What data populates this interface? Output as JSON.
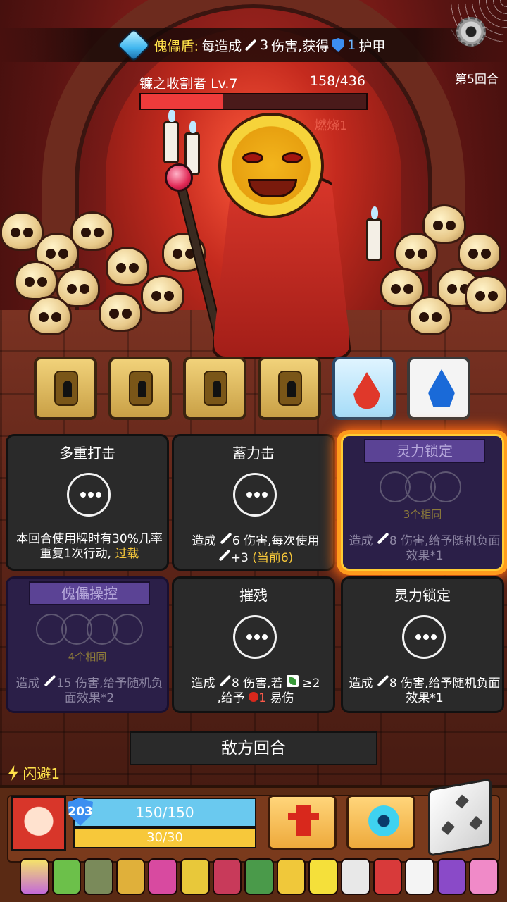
{
  "buff": {
    "icon": "puppet-shield-gem-icon",
    "name": "傀儡盾:",
    "text_before": "每造成",
    "damage": "3",
    "text_mid": "伤害,获得",
    "armor": "1",
    "text_after": "护甲"
  },
  "round": "第5回合",
  "boss": {
    "name": "镰之收割者",
    "level": "Lv.7",
    "hp_text": "158/436",
    "hp_fraction": 0.362,
    "status": "燃烧1"
  },
  "reward_boxes": [
    {
      "kind": "locked-chest"
    },
    {
      "kind": "locked-chest"
    },
    {
      "kind": "locked-chest"
    },
    {
      "kind": "locked-chest"
    },
    {
      "kind": "fire-ice"
    },
    {
      "kind": "water"
    }
  ],
  "cards": [
    {
      "title": "多重打击",
      "desc_a": "本回合使用牌时有30%几率重复1次行动,",
      "desc_b": "过载"
    },
    {
      "title": "蓄力击",
      "desc_a": "造成",
      "dmg": "6",
      "desc_b": "伤害,每次使用",
      "desc_c": "+3",
      "desc_d": "(当前6)"
    },
    {
      "title": "灵力锁定",
      "same": "3个相同",
      "desc_a": "造成",
      "dmg": "8",
      "desc_b": "伤害,给予随机负面效果*1"
    },
    {
      "title": "傀儡操控",
      "same": "4个相同",
      "desc_a": "造成",
      "dmg": "15",
      "desc_b": "伤害,给予随机负面效果*2"
    },
    {
      "title": "摧残",
      "desc_a": "造成",
      "dmg": "8",
      "desc_b": "伤害,若",
      "cond": "≥2",
      "desc_c": ",给予",
      "vuln": "1",
      "desc_d": "易伤"
    },
    {
      "title": "灵力锁定",
      "desc_a": "造成",
      "dmg": "8",
      "desc_b": "伤害,给予随机负面效果*1"
    }
  ],
  "enemy_turn": "敌方回合",
  "dodge": "闪避1",
  "player": {
    "armor": "203",
    "hp": "150/150",
    "energy": "30/30"
  },
  "colors": {
    "accent_yellow": "#f7c83a",
    "hp_blue": "#6ac9ef",
    "boss_red": "#ee3b3b",
    "locked_purple": "#2b1f48"
  }
}
